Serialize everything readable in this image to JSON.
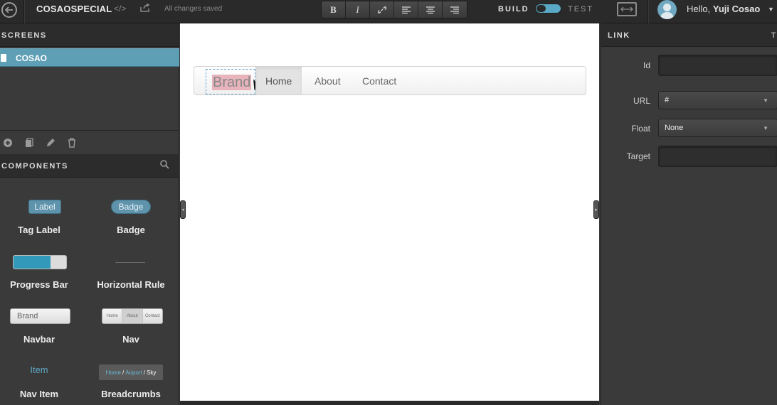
{
  "topbar": {
    "app_title": "COSAOSPECIAL",
    "code_icon": "</>",
    "save_status": "All changes saved",
    "format_buttons": [
      "B",
      "I",
      "🔗",
      "≡",
      "≡",
      "≡"
    ],
    "mode_build": "BUILD",
    "mode_test": "TEST",
    "greeting_prefix": "Hello,",
    "user_name": "Yuji Cosao"
  },
  "screens_panel": {
    "title": "SCREENS",
    "items": [
      {
        "label": "COSAO",
        "selected": true
      }
    ]
  },
  "components_panel": {
    "title": "COMPONENTS",
    "items": [
      {
        "name": "Tag Label",
        "preview": "Label"
      },
      {
        "name": "Badge",
        "preview": "Badge"
      },
      {
        "name": "Progress Bar",
        "preview_fill": 0.7
      },
      {
        "name": "Horizontal Rule"
      },
      {
        "name": "Navbar",
        "preview": "Brand"
      },
      {
        "name": "Nav",
        "preview_items": [
          "Home",
          "About",
          "Contact"
        ]
      },
      {
        "name": "Nav Item",
        "preview": "Item"
      },
      {
        "name": "Breadcrumbs",
        "preview_items": [
          "Home",
          "Airport",
          "Sky"
        ]
      }
    ]
  },
  "canvas": {
    "navbar": {
      "brand": "Brand",
      "links": [
        {
          "label": "Home",
          "active": true
        },
        {
          "label": "About",
          "active": false
        },
        {
          "label": "Contact",
          "active": false
        }
      ]
    }
  },
  "properties_panel": {
    "title": "LINK",
    "fields": [
      {
        "label": "Id",
        "value": ""
      },
      {
        "label": "URL",
        "value": "#"
      },
      {
        "label": "Float",
        "value": "None"
      },
      {
        "label": "Target",
        "value": ""
      }
    ]
  },
  "colors": {
    "accent": "#5e9fb5",
    "panel_bg": "#3a3a3a",
    "topbar_bg": "#2a2a2a",
    "canvas_bg": "#ffffff"
  }
}
